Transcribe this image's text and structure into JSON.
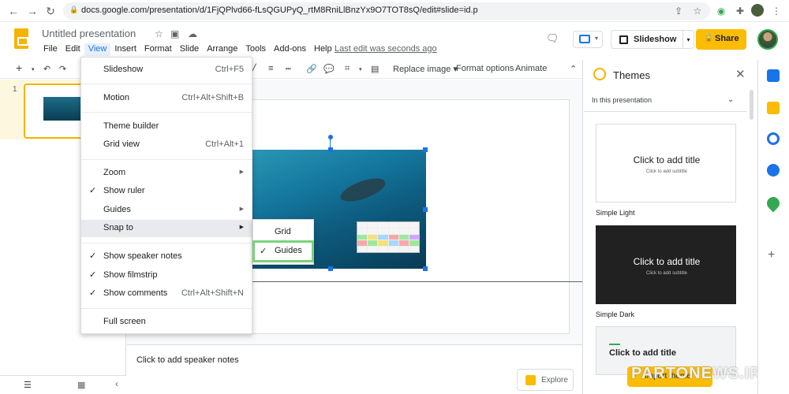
{
  "browser": {
    "url": "docs.google.com/presentation/d/1FjQPlvd66-fLsQGUPyQ_rtM8RniLlBnzYx9O7TOT8sQ/edit#slide=id.p"
  },
  "doc": {
    "title": "Untitled presentation",
    "last_edit": "Last edit was seconds ago",
    "slideshow_label": "Slideshow",
    "share_label": "Share"
  },
  "menubar": [
    "File",
    "Edit",
    "View",
    "Insert",
    "Format",
    "Slide",
    "Arrange",
    "Tools",
    "Add-ons",
    "Help"
  ],
  "toolbar": {
    "replace_image": "Replace image",
    "format_options": "Format options",
    "animate": "Animate"
  },
  "filmstrip": {
    "slide_number": "1"
  },
  "view_menu": {
    "slideshow": {
      "label": "Slideshow",
      "shortcut": "Ctrl+F5"
    },
    "motion": {
      "label": "Motion",
      "shortcut": "Ctrl+Alt+Shift+B"
    },
    "theme_builder": {
      "label": "Theme builder"
    },
    "grid_view": {
      "label": "Grid view",
      "shortcut": "Ctrl+Alt+1"
    },
    "zoom": {
      "label": "Zoom"
    },
    "show_ruler": {
      "label": "Show ruler",
      "checked": true
    },
    "guides": {
      "label": "Guides"
    },
    "snap_to": {
      "label": "Snap to"
    },
    "show_speaker_notes": {
      "label": "Show speaker notes",
      "checked": true
    },
    "show_filmstrip": {
      "label": "Show filmstrip",
      "checked": true
    },
    "show_comments": {
      "label": "Show comments",
      "shortcut": "Ctrl+Alt+Shift+N",
      "checked": true
    },
    "full_screen": {
      "label": "Full screen"
    }
  },
  "snap_submenu": {
    "grid": "Grid",
    "guides": "Guides"
  },
  "notes": {
    "placeholder": "Click to add speaker notes"
  },
  "explore": {
    "label": "Explore"
  },
  "themes": {
    "title": "Themes",
    "filter": "In this presentation",
    "cards": [
      {
        "title": "Click to add title",
        "subtitle": "Click to add subtitle",
        "name": "Simple Light"
      },
      {
        "title": "Click to add title",
        "subtitle": "Click to add subtitle",
        "name": "Simple Dark"
      },
      {
        "title": "Click to add title"
      }
    ],
    "import_label": "Import theme"
  },
  "watermark": "PARTONEWS.IR",
  "colors": {
    "accent": "#1a73e8",
    "brand": "#f4b400",
    "highlight": "#7bd27b"
  }
}
